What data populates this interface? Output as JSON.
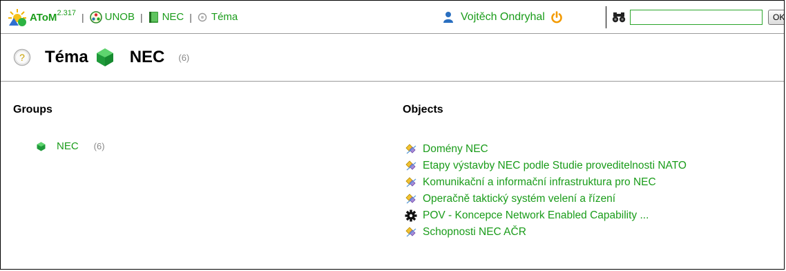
{
  "topbar": {
    "app_name": "AToM",
    "app_version": "2.317",
    "breadcrumbs": [
      {
        "label": "UNOB",
        "icon": "ontology-icon"
      },
      {
        "label": "NEC",
        "icon": "book-icon"
      },
      {
        "label": "Téma",
        "icon": "circle-type-icon"
      }
    ],
    "user_name": "Vojtěch Ondryhal",
    "search_value": "",
    "search_button_label": "OK"
  },
  "heading": {
    "type_label": "Téma",
    "title": "NEC",
    "count": "(6)"
  },
  "groups": {
    "title": "Groups",
    "items": [
      {
        "label": "NEC",
        "count": "(6)"
      }
    ]
  },
  "objects": {
    "title": "Objects",
    "items": [
      {
        "label": "Domény NEC",
        "icon": "relation-icon"
      },
      {
        "label": "Etapy výstavby NEC podle Studie proveditelnosti NATO",
        "icon": "relation-icon"
      },
      {
        "label": "Komunikační a informační infrastruktura pro NEC",
        "icon": "relation-icon"
      },
      {
        "label": "Operačně taktický systém velení a řízení",
        "icon": "relation-icon"
      },
      {
        "label": "POV - Koncepce Network Enabled Capability ...",
        "icon": "gear-icon"
      },
      {
        "label": "Schopnosti NEC AČR",
        "icon": "relation-icon"
      }
    ]
  },
  "colors": {
    "link": "#1a9c1a",
    "accent_gem": "#2bb34a",
    "count": "#888888"
  }
}
